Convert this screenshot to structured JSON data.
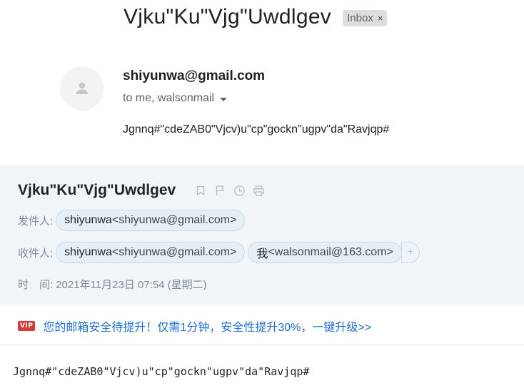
{
  "gmail": {
    "subject": "Vjku\"Ku\"Vjg\"Uwdlgev",
    "label_chip": "Inbox",
    "label_close": "×",
    "avatar_icon": "person-icon",
    "sender": "shiyunwa@gmail.com",
    "recipients_text": "to me, walsonmail",
    "body": "Jgnnq#\"cdeZAB0\"Vjcv)u\"cp\"gockn\"ugpv\"da\"Ravjqp#"
  },
  "netease": {
    "subject": "Vjku\"Ku\"Vjg\"Uwdlgev",
    "tool_icons": [
      "bookmark-icon",
      "flag-icon",
      "clock-icon",
      "print-icon"
    ],
    "from_label": "发件人:",
    "from": {
      "name": "shiyunwa",
      "address": "<shiyunwa@gmail.com>"
    },
    "to_label": "收件人:",
    "to": [
      {
        "name": "shiyunwa",
        "address": "<shiyunwa@gmail.com>"
      },
      {
        "name": "我",
        "address": "<walsonmail@163.com>"
      }
    ],
    "add_recipient": "+",
    "time_label": "时　间:",
    "time_value": "2021年11月23日 07:54 (星期二)",
    "vip_badge": "VIP",
    "banner_text": "您的邮箱安全待提升！仅需1分钟，安全性提升30%，一键升级>>",
    "body": "Jgnnq#\"cdeZAB0\"Vjcv)u\"cp\"gockn\"ugpv\"da\"Ravjqp#"
  },
  "colors": {
    "panel_bg": "#f2f5f8",
    "chip_bg": "#e6eef6",
    "link_blue": "#1f6fd1",
    "vip_red": "#d83a3a",
    "label_gray": "#7f8a96"
  }
}
